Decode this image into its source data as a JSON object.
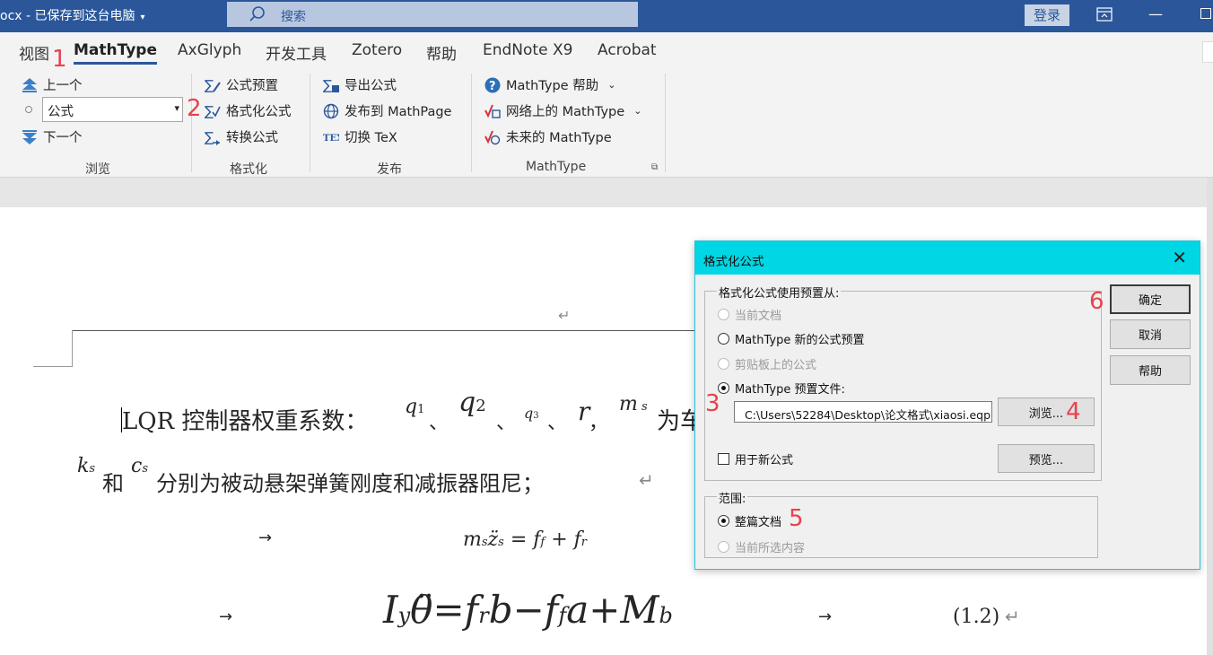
{
  "titlebar": {
    "doc_title": "ocx  -  已保存到这台电脑",
    "search_placeholder": "搜索",
    "login_label": "登录"
  },
  "tabs": [
    {
      "label": "视图"
    },
    {
      "label": "MathType",
      "active": true
    },
    {
      "label": "AxGlyph"
    },
    {
      "label": "开发工具"
    },
    {
      "label": "Zotero"
    },
    {
      "label": "帮助"
    },
    {
      "label": "EndNote X9"
    },
    {
      "label": "Acrobat"
    }
  ],
  "ribbon": {
    "browse": {
      "prev": "上一个",
      "style_value": "公式",
      "next": "下一个",
      "label": "浏览"
    },
    "format": {
      "presets": "公式预置",
      "format_eq": "格式化公式",
      "convert": "转换公式",
      "label": "格式化"
    },
    "publish": {
      "export": "导出公式",
      "publish_mathpage": "发布到 MathPage",
      "toggle_tex": "切换 TeX",
      "label": "发布"
    },
    "mathtype": {
      "help": "MathType 帮助",
      "web": "网络上的 MathType",
      "future": "未来的 MathType",
      "label": "MathType"
    }
  },
  "annotations": [
    "1",
    "2",
    "3",
    "4",
    "5",
    "6"
  ],
  "document": {
    "para_mark": "↵",
    "line1_prefix": "LQR 控制器权重系数：",
    "line1_sep1": "、",
    "line1_sep2": "、",
    "line1_sep3": "、",
    "line1_sep4": "，",
    "line1_tail": "为车",
    "line2_and": "和",
    "line2_text": "分别为被动悬架弹簧刚度和减振器阻尼；",
    "arrow": "→",
    "eq_number": "(1.2)"
  },
  "dialog": {
    "title": "格式化公式",
    "source_group": {
      "legend": "格式化公式使用预置从:",
      "options": [
        {
          "label": "当前文档",
          "state": "disabled"
        },
        {
          "label": "MathType 新的公式预置",
          "state": "normal"
        },
        {
          "label": "剪贴板上的公式",
          "state": "disabled"
        },
        {
          "label": "MathType 预置文件:",
          "state": "checked"
        }
      ],
      "file_path": "C:\\Users\\52284\\Desktop\\论文格式\\xiaosi.eqp",
      "browse_button": "浏览...",
      "use_for_new": "用于新公式",
      "preview_button": "预览..."
    },
    "scope_group": {
      "legend": "范围:",
      "options": [
        {
          "label": "整篇文档",
          "state": "checked"
        },
        {
          "label": "当前所选内容",
          "state": "disabled"
        }
      ]
    },
    "ok_button": "确定",
    "cancel_button": "取消",
    "help_button": "帮助"
  },
  "colors": {
    "titlebar": "#2b579a",
    "ribbon_bg": "#f3f3f3",
    "dialog_titlebar": "#00d6e4",
    "annotation": "#e8424f"
  }
}
